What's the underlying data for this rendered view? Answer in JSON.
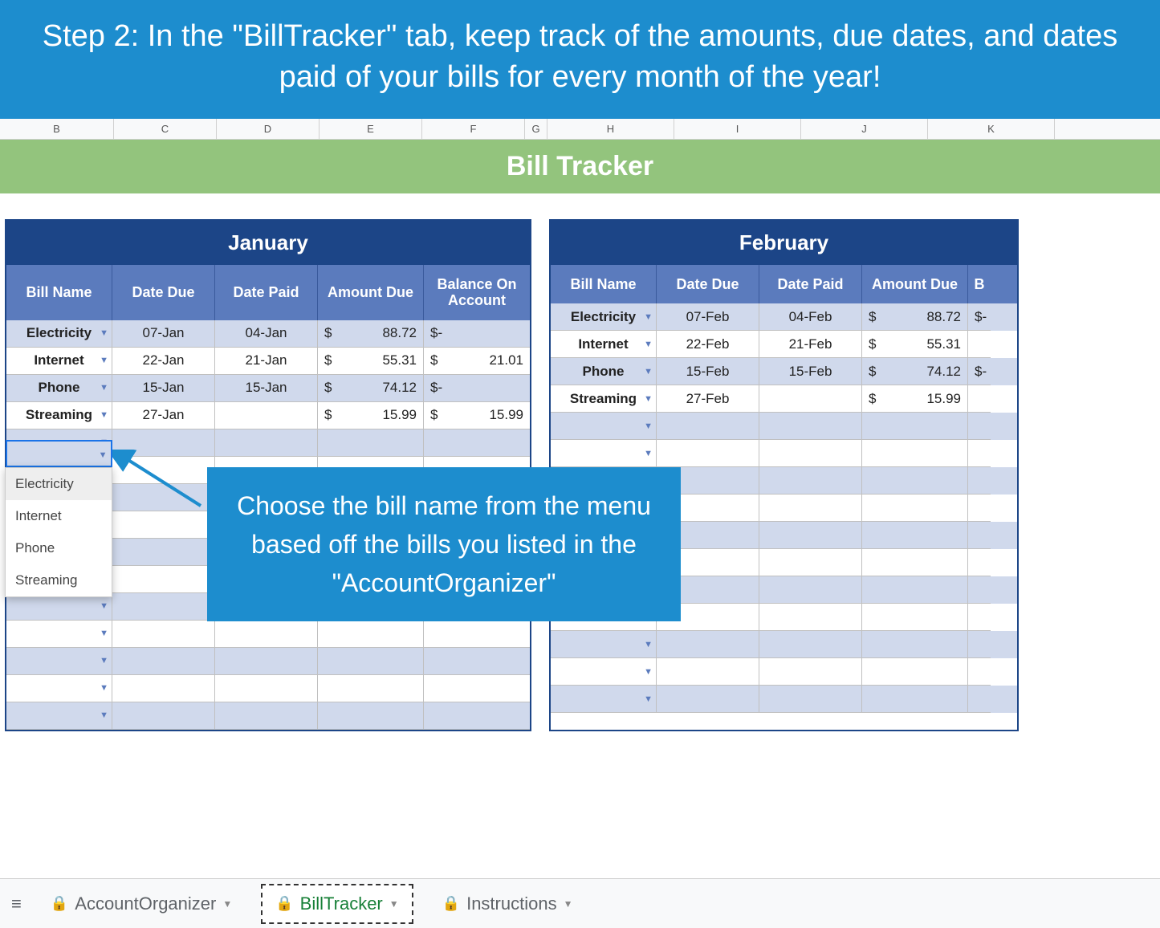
{
  "instruction": "Step 2: In the \"BillTracker\" tab, keep track of the amounts, due dates, and dates paid of your bills for every month of the year!",
  "column_letters": [
    "B",
    "C",
    "D",
    "E",
    "F",
    "G",
    "H",
    "I",
    "J",
    "K"
  ],
  "sheet_title": "Bill Tracker",
  "months": {
    "jan": {
      "name": "January",
      "headers": [
        "Bill Name",
        "Date Due",
        "Date Paid",
        "Amount Due",
        "Balance On Account"
      ],
      "rows": [
        {
          "bill": "Electricity",
          "due": "07-Jan",
          "paid": "04-Jan",
          "amount": "88.72",
          "balance": "-"
        },
        {
          "bill": "Internet",
          "due": "22-Jan",
          "paid": "21-Jan",
          "amount": "55.31",
          "balance": "21.01"
        },
        {
          "bill": "Phone",
          "due": "15-Jan",
          "paid": "15-Jan",
          "amount": "74.12",
          "balance": "-"
        },
        {
          "bill": "Streaming",
          "due": "27-Jan",
          "paid": "",
          "amount": "15.99",
          "balance": "15.99"
        }
      ]
    },
    "feb": {
      "name": "February",
      "headers": [
        "Bill Name",
        "Date Due",
        "Date Paid",
        "Amount Due",
        "B"
      ],
      "rows": [
        {
          "bill": "Electricity",
          "due": "07-Feb",
          "paid": "04-Feb",
          "amount": "88.72",
          "balance": "-"
        },
        {
          "bill": "Internet",
          "due": "22-Feb",
          "paid": "21-Feb",
          "amount": "55.31",
          "balance": ""
        },
        {
          "bill": "Phone",
          "due": "15-Feb",
          "paid": "15-Feb",
          "amount": "74.12",
          "balance": "-"
        },
        {
          "bill": "Streaming",
          "due": "27-Feb",
          "paid": "",
          "amount": "15.99",
          "balance": ""
        }
      ]
    }
  },
  "dropdown_options": [
    "Electricity",
    "Internet",
    "Phone",
    "Streaming"
  ],
  "callout_text": "Choose the bill name from the menu based off the bills you listed in the \"AccountOrganizer\"",
  "tabs": {
    "account": "AccountOrganizer",
    "bill": "BillTracker",
    "instructions": "Instructions"
  },
  "empty_row_count": 11,
  "currency_symbol": "$"
}
